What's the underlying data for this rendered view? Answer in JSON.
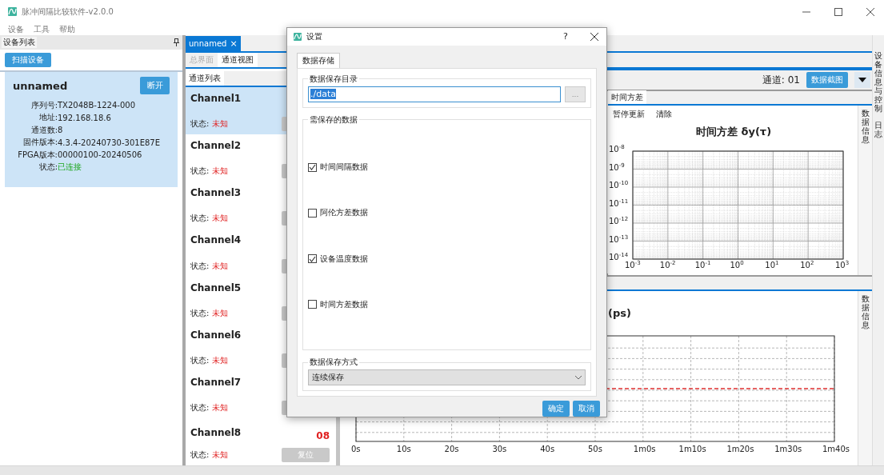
{
  "window": {
    "title": "脉冲间隔比较软件-v2.0.0"
  },
  "menu": [
    "设备",
    "工具",
    "帮助"
  ],
  "device_panel": {
    "title": "设备列表",
    "scan_button": "扫描设备",
    "device": {
      "name": "unnamed",
      "disconnect_button": "断开",
      "fields": [
        {
          "label": "序列号:",
          "value": "TX2048B-1224-000",
          "kind": "plain"
        },
        {
          "label": "地址:",
          "value": "192.168.18.6",
          "kind": "plain"
        },
        {
          "label": "通道数:",
          "value": "8",
          "kind": "plain"
        },
        {
          "label": "固件版本:",
          "value": "4.3.4-20240730-301E87E",
          "kind": "plain"
        },
        {
          "label": "FPGA版本:",
          "value": "00000100-20240506",
          "kind": "plain"
        },
        {
          "label": "状态:",
          "value": "已连接",
          "kind": "status"
        }
      ]
    }
  },
  "document_tab": {
    "label": "unnamed",
    "close": "×"
  },
  "view_tabs": [
    {
      "label": "总界面",
      "selected": false,
      "disabled": true
    },
    {
      "label": "通道视图",
      "selected": true,
      "disabled": false
    }
  ],
  "channel_list": {
    "tab": "通道列表",
    "channels": [
      {
        "name": "Channel1",
        "status_label": "状态:",
        "status": "未知",
        "selected": true
      },
      {
        "name": "Channel2",
        "status_label": "状态:",
        "status": "未知",
        "selected": false
      },
      {
        "name": "Channel3",
        "status_label": "状态:",
        "status": "未知",
        "selected": false
      },
      {
        "name": "Channel4",
        "status_label": "状态:",
        "status": "未知",
        "selected": false
      },
      {
        "name": "Channel5",
        "status_label": "状态:",
        "status": "未知",
        "selected": false
      },
      {
        "name": "Channel6",
        "status_label": "状态:",
        "status": "未知",
        "selected": false
      },
      {
        "name": "Channel7",
        "status_label": "状态:",
        "status": "未知",
        "selected": false
      },
      {
        "name": "Channel8",
        "status_label": "状态:",
        "status": "未知",
        "selected": false,
        "value": "08",
        "button": "复位"
      }
    ]
  },
  "channel_header": {
    "label": "通道: 01",
    "screenshot_button": "数据截图"
  },
  "variance_dock": {
    "tab": "时间方差",
    "tools": [
      "暂停更新",
      "清除"
    ],
    "side_tab": "数据信息",
    "plot": {
      "title": "时间方差 δy(τ)",
      "x_labels": [
        "10$^{-3}$",
        "10$^{-2}$",
        "10$^{-1}$",
        "10$^{0}$",
        "10$^{1}$",
        "10$^{2}$",
        "10$^{3}$"
      ],
      "y_labels": [
        "10$^{-8}$",
        "10$^{-9}$",
        "10$^{-10}$",
        "10$^{-11}$",
        "10$^{-12}$",
        "10$^{-13}$",
        "10$^{-14}$"
      ]
    }
  },
  "interval_dock": {
    "side_tab": "数据信息",
    "plot": {
      "title": "(ps)",
      "x_labels": [
        "0s",
        "10s",
        "20s",
        "30s",
        "40s",
        "50s",
        "1m0s",
        "1m10s",
        "1m20s",
        "1m30s",
        "1m40s"
      ]
    }
  },
  "side_tabs": [
    "设备信息与控制",
    "日志"
  ],
  "dialog": {
    "title": "设置",
    "help": "?",
    "tab": "数据存储",
    "directory_group": {
      "label": "数据保存目录",
      "value": "./data",
      "browse_button": "..."
    },
    "data_group": {
      "label": "需保存的数据",
      "options": [
        {
          "label": "时间间隔数据",
          "checked": true
        },
        {
          "label": "阿伦方差数据",
          "checked": false
        },
        {
          "label": "设备温度数据",
          "checked": true
        },
        {
          "label": "时间方差数据",
          "checked": false
        }
      ]
    },
    "mode_group": {
      "label": "数据保存方式",
      "value": "连续保存"
    },
    "buttons": [
      "确定",
      "取消"
    ]
  }
}
